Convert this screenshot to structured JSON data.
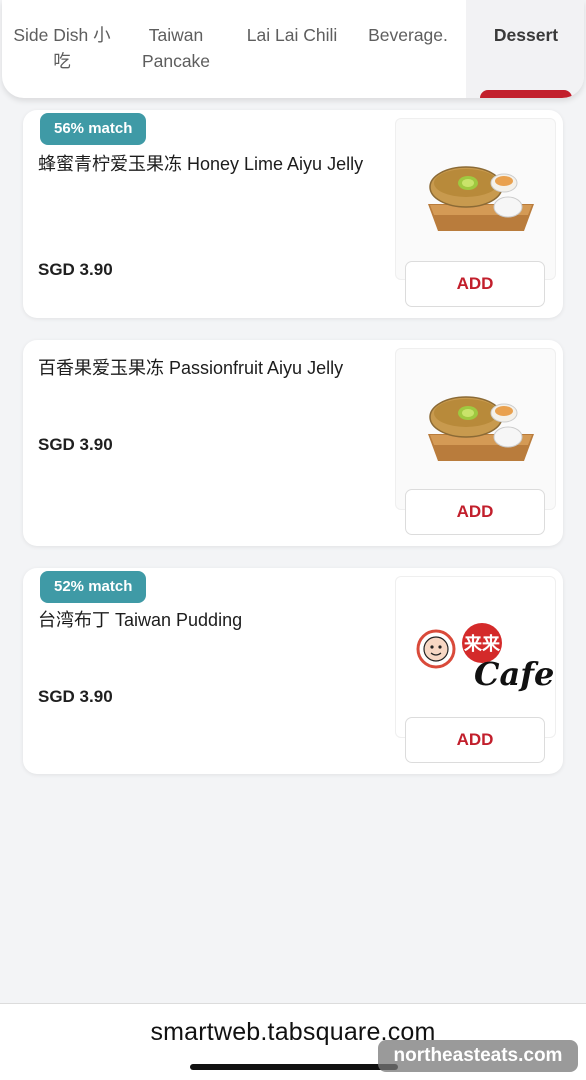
{
  "tabs": [
    {
      "line1": "Side Dish 小",
      "line2": "吃"
    },
    {
      "line1": "Taiwan",
      "line2": "Pancake"
    },
    {
      "line1": "Lai Lai Chili",
      "line2": ""
    },
    {
      "line1": "Beverage.",
      "line2": ""
    },
    {
      "line1": "Dessert",
      "line2": ""
    }
  ],
  "active_tab": "Dessert",
  "items": [
    {
      "match": "56% match",
      "name": "蜂蜜青柠爱玉果冻 Honey Lime Aiyu Jelly",
      "price": "SGD 3.90",
      "add_label": "ADD",
      "image": "aiyu-jelly-honey-lime"
    },
    {
      "match": "",
      "name": "百香果爱玉果冻 Passionfruit Aiyu Jelly",
      "price": "SGD 3.90",
      "add_label": "ADD",
      "image": "aiyu-jelly-passionfruit"
    },
    {
      "match": "52% match",
      "name": "台湾布丁 Taiwan Pudding",
      "price": "SGD 3.90",
      "add_label": "ADD",
      "image": "cafe-logo",
      "logo_text": "Cafe",
      "logo_chinese": "来来"
    }
  ],
  "browser": {
    "url": "smartweb.tabsquare.com"
  },
  "watermark": "northeasteats.com",
  "colors": {
    "accent": "#c21f2c",
    "badge": "#3f9aa6",
    "background": "#f3f4f6"
  }
}
